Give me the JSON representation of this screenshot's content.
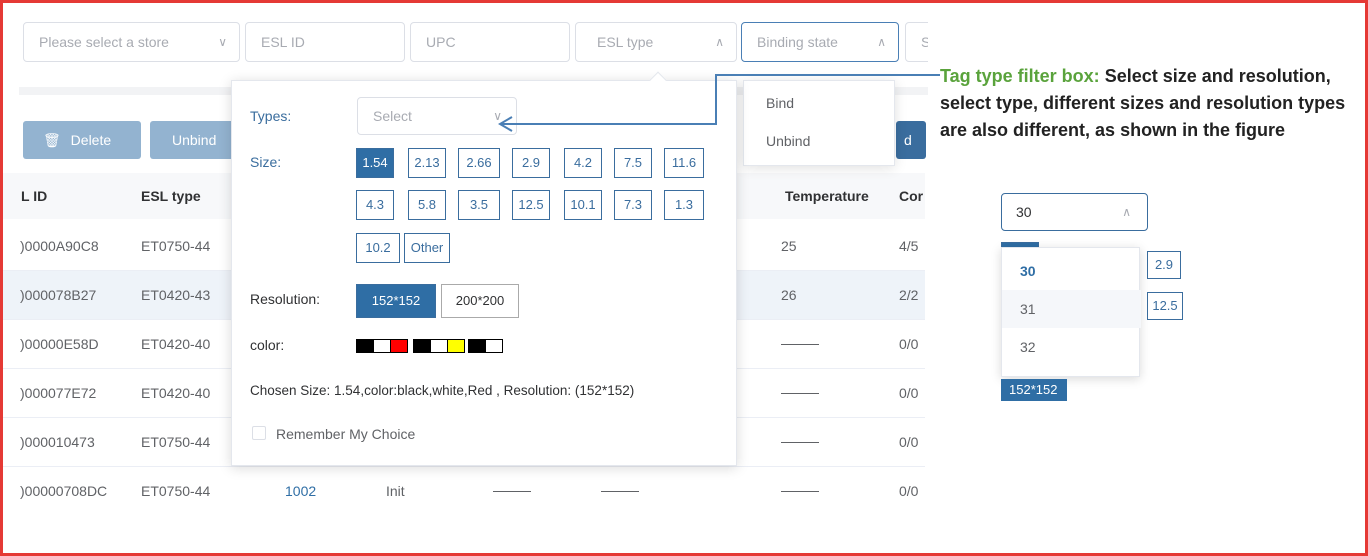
{
  "filters": {
    "store": "Please select a store",
    "esl_id": "ESL ID",
    "upc": "UPC",
    "esl_type": "ESL type",
    "binding_state": "Binding state",
    "cut_char": "S"
  },
  "toolbar": {
    "delete_label": "Delete",
    "unbind_label": "Unbind",
    "right_btn_label": "d"
  },
  "table": {
    "headers": {
      "esl_id": "L ID",
      "esl_type": "ESL type",
      "temperature": "Temperature",
      "con": "Cor"
    },
    "rows": [
      {
        "id": ")0000A90C8",
        "type": "ET0750-44",
        "temp": "25",
        "con": "4/5"
      },
      {
        "id": ")000078B27",
        "type": "ET0420-43",
        "temp": "26",
        "con": "2/2"
      },
      {
        "id": ")00000E58D",
        "type": "ET0420-40",
        "temp": "",
        "con": "0/0"
      },
      {
        "id": ")000077E72",
        "type": "ET0420-40",
        "temp": "",
        "con": "0/0"
      },
      {
        "id": ")000010473",
        "type": "ET0750-44",
        "temp": "",
        "con": "0/0"
      },
      {
        "id": ")00000708DC",
        "type": "ET0750-44",
        "temp": "",
        "con": "0/0",
        "store": "1002",
        "state": "Init"
      }
    ],
    "partial_cells": {
      "store": "1002",
      "state": "Init"
    }
  },
  "popover": {
    "types_label": "Types:",
    "types_placeholder": "Select",
    "size_label": "Size:",
    "sizes": [
      "1.54",
      "2.13",
      "2.66",
      "2.9",
      "4.2",
      "7.5",
      "11.6",
      "4.3",
      "5.8",
      "3.5",
      "12.5",
      "10.1",
      "7.3",
      "1.3",
      "10.2",
      "Other"
    ],
    "resolution_label": "Resolution:",
    "resolutions": [
      "152*152",
      "200*200"
    ],
    "color_label": "color:",
    "colors": [
      "#000000",
      "#ffffff",
      "#ff0000",
      "#000000",
      "#ffffff",
      "#ffff00",
      "#000000",
      "#ffffff"
    ],
    "chosen_text": "Chosen Size: 1.54,color:black,white,Red , Resolution:   (152*152)",
    "remember_label": "Remember My Choice"
  },
  "binding_dropdown": {
    "options": [
      "Bind",
      "Unbind"
    ]
  },
  "annotation": {
    "heading": "Tag type filter box:",
    "body": " Select size and resolution, select type, different sizes and resolution types are also different, as shown in the figure"
  },
  "demo": {
    "select_value": "30",
    "options": [
      "30",
      "31",
      "32"
    ],
    "chips": [
      "2.9",
      "12.5"
    ],
    "resolution": "152*152"
  },
  "colors": {
    "accent": "#2f6ea5",
    "frame": "#e53935",
    "annotation_heading": "#5aa33c"
  }
}
